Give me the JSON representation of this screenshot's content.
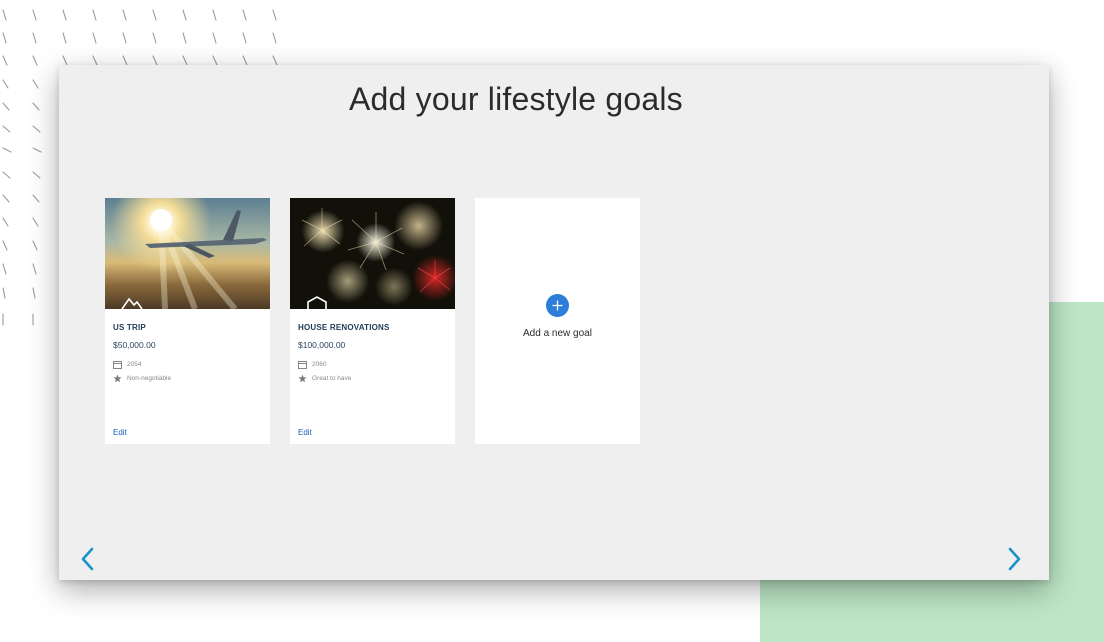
{
  "page": {
    "title": "Add your lifestyle goals"
  },
  "goals": [
    {
      "name": "US TRIP",
      "amount": "$50,000.00",
      "year": "2054",
      "priority": "Non-negotiable",
      "edit_label": "Edit",
      "image": "airplane-above-clouds",
      "category_icon": "travel-icon"
    },
    {
      "name": "HOUSE RENOVATIONS",
      "amount": "$100,000.00",
      "year": "2060",
      "priority": "Great to have",
      "edit_label": "Edit",
      "image": "fireworks",
      "category_icon": "home-icon"
    }
  ],
  "add_goal": {
    "label": "Add a new goal",
    "icon": "plus-icon"
  },
  "navigation": {
    "prev_icon": "chevron-left-icon",
    "next_icon": "chevron-right-icon"
  },
  "colors": {
    "accent": "#2d7ddb",
    "link": "#1c5fb8",
    "arrow": "#1a93c7",
    "panel": "#efefef",
    "decor_green": "#bde6c6"
  }
}
